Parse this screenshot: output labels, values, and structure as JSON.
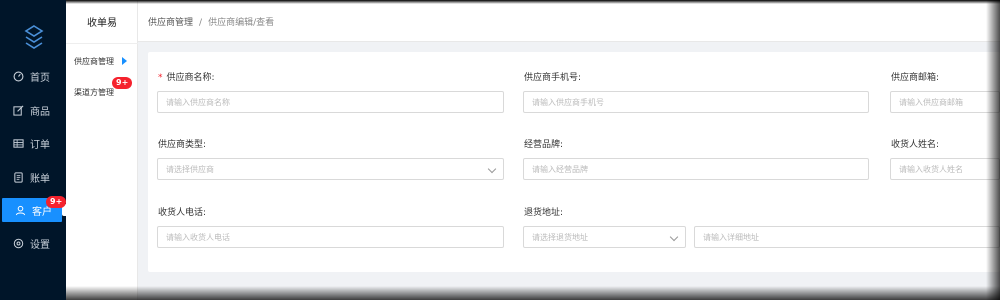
{
  "nav": {
    "items": [
      {
        "label": "首页",
        "icon": "dashboard-icon"
      },
      {
        "label": "商品",
        "icon": "edit-icon"
      },
      {
        "label": "订单",
        "icon": "table-icon"
      },
      {
        "label": "账单",
        "icon": "bill-icon"
      },
      {
        "label": "客户",
        "icon": "user-icon",
        "active": true,
        "badge": "9+"
      },
      {
        "label": "设置",
        "icon": "settings-icon"
      }
    ]
  },
  "submenu": {
    "title": "收单易",
    "items": [
      {
        "label": "供应商管理",
        "active": true
      },
      {
        "label": "渠道方管理",
        "badge": "9+"
      }
    ]
  },
  "breadcrumb": {
    "parent": "供应商管理",
    "separator": "/",
    "current": "供应商编辑/查看"
  },
  "form": {
    "supplier_name": {
      "label": "供应商名称:",
      "required": "*",
      "placeholder": "请输入供应商名称"
    },
    "supplier_phone": {
      "label": "供应商手机号:",
      "placeholder": "请输入供应商手机号"
    },
    "supplier_email": {
      "label": "供应商邮箱:",
      "placeholder": "请输入供应商邮箱"
    },
    "supplier_type": {
      "label": "供应商类型:",
      "placeholder": "请选择供应商"
    },
    "brand": {
      "label": "经营品牌:",
      "placeholder": "请输入经营品牌"
    },
    "consignee_name": {
      "label": "收货人姓名:",
      "placeholder": "请输入收货人姓名"
    },
    "consignee_phone": {
      "label": "收货人电话:",
      "placeholder": "请输入收货人电话"
    },
    "return_address": {
      "label": "退货地址:",
      "placeholder": "请选择退货地址",
      "detail_placeholder": "请输入详细地址"
    }
  },
  "colors": {
    "nav_bg": "#001529",
    "accent": "#1890ff",
    "badge": "#f5222d"
  }
}
